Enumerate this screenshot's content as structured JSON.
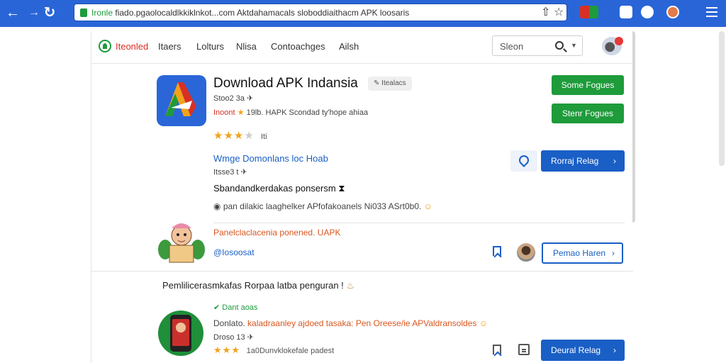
{
  "browser": {
    "url_domain": "Ironle",
    "url_rest": "fiado.pgaolocaldlkkiklnkot...com",
    "url_title": "Aktdahamacals sloboddiaithacm APK loosaris"
  },
  "site": {
    "brand": "Iteonled",
    "nav": [
      "Itaers",
      "Lolturs",
      "Nlisa",
      "Contoachges",
      "Ailsh"
    ],
    "search_placeholder": "Sleon"
  },
  "app": {
    "title": "Download APK Indansia",
    "tag": "Itealacs",
    "meta": "Stoo2 3a",
    "developer_label": "Inoont",
    "developer_rest": "19lb. HAPK Scondad ty'hope ahiaa",
    "rating_text": "Iti",
    "rating_value": 3.5,
    "btn_primary": "Some Fogues",
    "btn_secondary": "Stenr Fogues"
  },
  "section": {
    "title": "Wmge Domonlans loc Hoab",
    "meta": "Itsse3 t",
    "subtitle": "Sbandandkerdakas ponsersm",
    "desc": "pan dilakic laaghelker APfofakoanels Ni033 ASrt0b0.",
    "report_button": "Rorraj Relag",
    "orange_line": "Panelclaclacenia ponened. UAPK",
    "blue_link": "@Iosoosat",
    "pemao_button": "Pemao Haren"
  },
  "comment": {
    "text": "Pemlilicerasmkafas Rorpaa latba penguran !"
  },
  "second_app": {
    "label": "Dant aoas",
    "desc_prefix": "Donlato.",
    "desc_orange": "kaladraanley ajdoed tasaka: Pen Oreese/ie APValdransoldes",
    "meta": "Droso 13",
    "rating_value": 3,
    "rating_text": "1a0Dunvklokefale padest",
    "button": "Deural Relag"
  },
  "colors": {
    "chrome": "#2a65d8",
    "green": "#1e9b3b",
    "blue": "#1a5fc5",
    "red": "#d93025",
    "star": "#f2a21b"
  }
}
